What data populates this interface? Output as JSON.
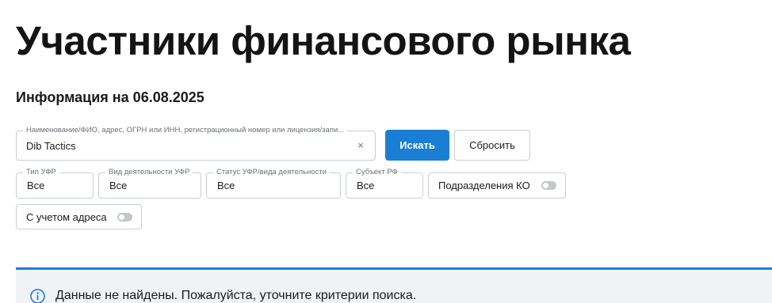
{
  "page": {
    "title": "Участники финансового рынка",
    "info_date": "Информация на 06.08.2025"
  },
  "search": {
    "label": "Наименование/ФИО, адрес, ОГРН или ИНН, регистрационный номер или лицензия/запи...",
    "value": "Dib Tactics",
    "clear_glyph": "×",
    "clear_icon": "close-icon"
  },
  "buttons": {
    "search_label": "Искать",
    "reset_label": "Сбросить"
  },
  "filters": {
    "type": {
      "label": "Тип УФР",
      "value": "Все"
    },
    "activity": {
      "label": "Вид деятельности УФР",
      "value": "Все"
    },
    "status": {
      "label": "Статус УФР/вида деятельности",
      "value": "Все"
    },
    "subject": {
      "label": "Субъект РФ",
      "value": "Все"
    }
  },
  "toggles": {
    "ko_divisions": {
      "label": "Подразделения КО",
      "enabled": false
    },
    "with_address": {
      "label": "С учетом адреса",
      "enabled": false
    }
  },
  "notice": {
    "icon": "info-icon",
    "text": "Данные не найдены. Пожалуйста, уточните критерии поиска."
  },
  "colors": {
    "accent": "#1a7fd4",
    "notice_bg": "#f1f2f4",
    "border": "#c9ced6",
    "toggle_off": "#c4c7cc"
  }
}
